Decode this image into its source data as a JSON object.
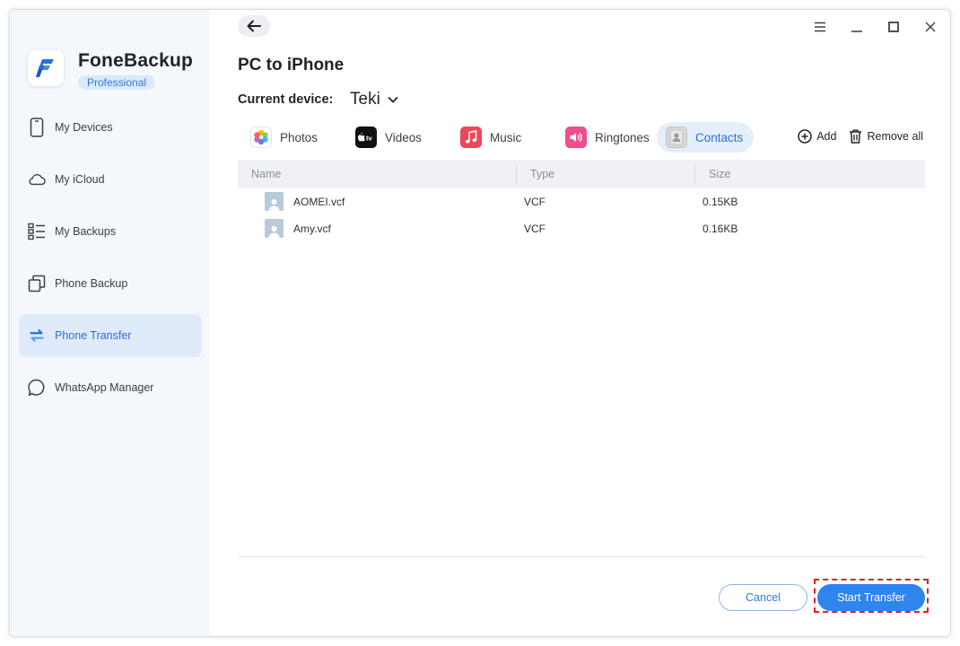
{
  "app": {
    "name": "FoneBackup",
    "edition": "Professional",
    "accent_color": "#2f7be0"
  },
  "sidebar": {
    "items": [
      {
        "label": "My Devices",
        "icon": "phone-icon",
        "active": false
      },
      {
        "label": "My iCloud",
        "icon": "cloud-icon",
        "active": false
      },
      {
        "label": "My Backups",
        "icon": "list-icon",
        "active": false
      },
      {
        "label": "Phone Backup",
        "icon": "copy-icon",
        "active": false
      },
      {
        "label": "Phone Transfer",
        "icon": "transfer-arrows-icon",
        "active": true
      },
      {
        "label": "WhatsApp Manager",
        "icon": "chat-bubble-icon",
        "active": false
      }
    ]
  },
  "header": {
    "title": "PC to iPhone",
    "device_label": "Current device:",
    "device_name": "Teki"
  },
  "tabs": [
    {
      "label": "Photos",
      "icon": "photos-icon",
      "active": false
    },
    {
      "label": "Videos",
      "icon": "apple-tv-icon",
      "active": false
    },
    {
      "label": "Music",
      "icon": "music-note-icon",
      "active": false
    },
    {
      "label": "Ringtones",
      "icon": "speaker-icon",
      "active": false
    },
    {
      "label": "Contacts",
      "icon": "contacts-icon",
      "active": true
    }
  ],
  "actions": {
    "add_label": "Add",
    "remove_all_label": "Remove all"
  },
  "table": {
    "columns": [
      "Name",
      "Type",
      "Size"
    ],
    "rows": [
      {
        "name": "AOMEI.vcf",
        "type": "VCF",
        "size": "0.15KB"
      },
      {
        "name": "Amy.vcf",
        "type": "VCF",
        "size": "0.16KB"
      }
    ]
  },
  "footer": {
    "cancel_label": "Cancel",
    "start_label": "Start Transfer"
  }
}
